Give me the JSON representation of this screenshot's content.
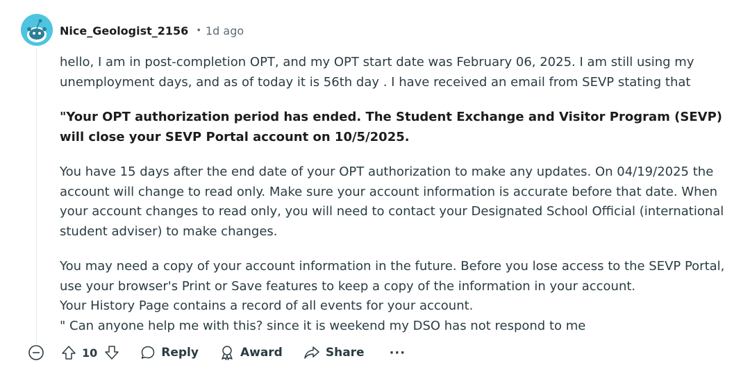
{
  "comment": {
    "author": "Nice_Geologist_2156",
    "separator": "•",
    "time": "1d ago",
    "avatar_icon": "snoo-avatar-icon",
    "paragraphs": {
      "p1": "hello, I am in post-completion OPT, and my OPT start date was February 06, 2025. I am still using my unemployment days, and as of today it is 56th day . I have received an email from SEVP stating that",
      "p2_bold": "\"Your OPT authorization period has ended. The Student Exchange and Visitor Program (SEVP) will close your SEVP Portal account on 10/5/2025.",
      "p3": "You have 15 days after the end date of your OPT authorization to make any updates. On 04/19/2025 the account will change to read only. Make sure your account information is accurate before that date. When your account changes to read only, you will need to contact your Designated School Official (international student adviser) to make changes.",
      "p4_line1": "You may need a copy of your account information in the future. Before you lose access to the SEVP Portal, use your browser's Print or Save features to keep a copy of the information in your account.",
      "p4_line2": "Your History Page contains a record of all events for your account.",
      "p4_line3": "\" Can anyone help me with this? since it is weekend my DSO has not respond to me"
    }
  },
  "actions": {
    "collapse_icon": "minus-circle-icon",
    "upvote_icon": "arrow-up-icon",
    "score": "10",
    "downvote_icon": "arrow-down-icon",
    "reply_label": "Reply",
    "reply_icon": "speech-bubble-icon",
    "award_label": "Award",
    "award_icon": "award-icon",
    "share_label": "Share",
    "share_icon": "share-arrow-icon",
    "more_label": "···"
  },
  "colors": {
    "avatar_bg": "#4dc4e0",
    "text": "#2a3c42",
    "muted": "#5e6b73",
    "thread_line": "#e5ebee"
  }
}
